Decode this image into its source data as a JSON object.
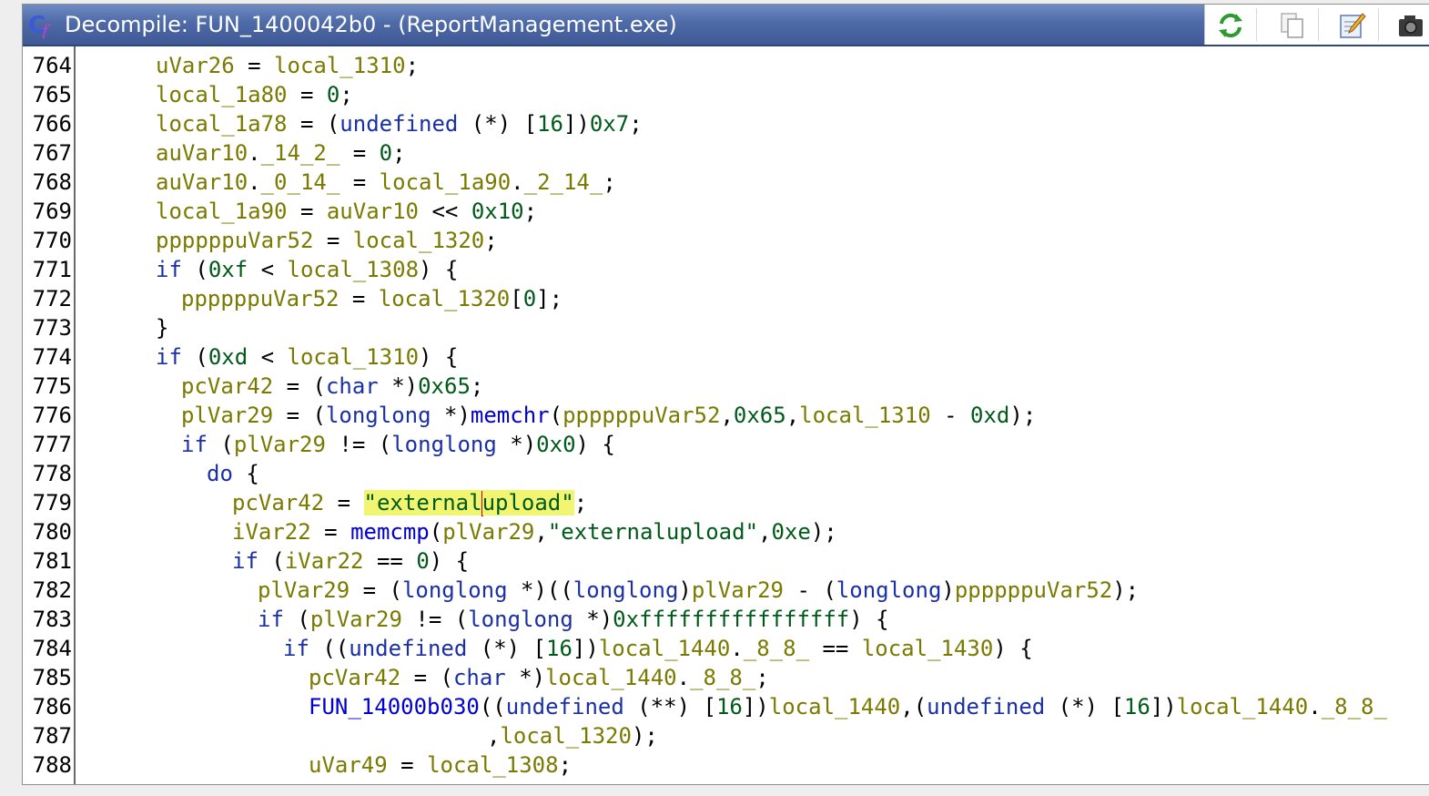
{
  "window": {
    "title": "Decompile: FUN_1400042b0 -  (ReportManagement.exe)",
    "toolbar": [
      "refresh-icon",
      "copy-icon",
      "edit-icon",
      "snapshot-icon"
    ]
  },
  "colors": {
    "titlebar": "#4e6aa7",
    "variable": "#7a7a00",
    "keyword": "#1a2fa8",
    "function": "#0000d0",
    "constant": "#005a1a",
    "highlight": "#f1f572",
    "cursor": "#d00000"
  },
  "code": {
    "line_numbers": [
      "764",
      "765",
      "766",
      "767",
      "768",
      "769",
      "770",
      "771",
      "772",
      "773",
      "774",
      "775",
      "776",
      "777",
      "778",
      "779",
      "780",
      "781",
      "782",
      "783",
      "784",
      "785",
      "786",
      "787",
      "788"
    ],
    "lines": [
      [
        [
          "v",
          "uVar26"
        ],
        [
          "p",
          " = "
        ],
        [
          "v",
          "local_1310"
        ],
        [
          "p",
          ";"
        ]
      ],
      [
        [
          "v",
          "local_1a80"
        ],
        [
          "p",
          " = "
        ],
        [
          "c",
          "0"
        ],
        [
          "p",
          ";"
        ]
      ],
      [
        [
          "v",
          "local_1a78"
        ],
        [
          "p",
          " = ("
        ],
        [
          "k",
          "undefined"
        ],
        [
          "p",
          " (*) ["
        ],
        [
          "c",
          "16"
        ],
        [
          "p",
          "])"
        ],
        [
          "c",
          "0x7"
        ],
        [
          "p",
          ";"
        ]
      ],
      [
        [
          "v",
          "auVar10"
        ],
        [
          "p",
          "."
        ],
        [
          "v",
          "_14_2_"
        ],
        [
          "p",
          " = "
        ],
        [
          "c",
          "0"
        ],
        [
          "p",
          ";"
        ]
      ],
      [
        [
          "v",
          "auVar10"
        ],
        [
          "p",
          "."
        ],
        [
          "v",
          "_0_14_"
        ],
        [
          "p",
          " = "
        ],
        [
          "v",
          "local_1a90"
        ],
        [
          "p",
          "."
        ],
        [
          "v",
          "_2_14_"
        ],
        [
          "p",
          ";"
        ]
      ],
      [
        [
          "v",
          "local_1a90"
        ],
        [
          "p",
          " = "
        ],
        [
          "v",
          "auVar10"
        ],
        [
          "p",
          " << "
        ],
        [
          "c",
          "0x10"
        ],
        [
          "p",
          ";"
        ]
      ],
      [
        [
          "v",
          "ppppppuVar52"
        ],
        [
          "p",
          " = "
        ],
        [
          "v",
          "local_1320"
        ],
        [
          "p",
          ";"
        ]
      ],
      [
        [
          "k",
          "if"
        ],
        [
          "p",
          " ("
        ],
        [
          "c",
          "0xf"
        ],
        [
          "p",
          " < "
        ],
        [
          "v",
          "local_1308"
        ],
        [
          "p",
          ") {"
        ]
      ],
      [
        [
          "v",
          "ppppppuVar52"
        ],
        [
          "p",
          " = "
        ],
        [
          "v",
          "local_1320"
        ],
        [
          "p",
          "["
        ],
        [
          "c",
          "0"
        ],
        [
          "p",
          "];"
        ]
      ],
      [
        [
          "p",
          "}"
        ]
      ],
      [
        [
          "k",
          "if"
        ],
        [
          "p",
          " ("
        ],
        [
          "c",
          "0xd"
        ],
        [
          "p",
          " < "
        ],
        [
          "v",
          "local_1310"
        ],
        [
          "p",
          ") {"
        ]
      ],
      [
        [
          "v",
          "pcVar42"
        ],
        [
          "p",
          " = ("
        ],
        [
          "k",
          "char"
        ],
        [
          "p",
          " *)"
        ],
        [
          "c",
          "0x65"
        ],
        [
          "p",
          ";"
        ]
      ],
      [
        [
          "v",
          "plVar29"
        ],
        [
          "p",
          " = ("
        ],
        [
          "k",
          "longlong"
        ],
        [
          "p",
          " *)"
        ],
        [
          "f",
          "memchr"
        ],
        [
          "p",
          "("
        ],
        [
          "v",
          "ppppppuVar52"
        ],
        [
          "p",
          ","
        ],
        [
          "c",
          "0x65"
        ],
        [
          "p",
          ","
        ],
        [
          "v",
          "local_1310"
        ],
        [
          "p",
          " - "
        ],
        [
          "c",
          "0xd"
        ],
        [
          "p",
          ");"
        ]
      ],
      [
        [
          "k",
          "if"
        ],
        [
          "p",
          " ("
        ],
        [
          "v",
          "plVar29"
        ],
        [
          "p",
          " != ("
        ],
        [
          "k",
          "longlong"
        ],
        [
          "p",
          " *)"
        ],
        [
          "c",
          "0x0"
        ],
        [
          "p",
          ") {"
        ]
      ],
      [
        [
          "k",
          "do"
        ],
        [
          "p",
          " {"
        ]
      ],
      [
        [
          "v",
          "pcVar42"
        ],
        [
          "p",
          " = "
        ],
        [
          "h",
          "\"external"
        ],
        [
          "cur",
          ""
        ],
        [
          "h",
          "upload\""
        ],
        [
          "p",
          ";"
        ]
      ],
      [
        [
          "v",
          "iVar22"
        ],
        [
          "p",
          " = "
        ],
        [
          "f",
          "memcmp"
        ],
        [
          "p",
          "("
        ],
        [
          "v",
          "plVar29"
        ],
        [
          "p",
          ","
        ],
        [
          "s",
          "\"externalupload\""
        ],
        [
          "p",
          ","
        ],
        [
          "c",
          "0xe"
        ],
        [
          "p",
          ");"
        ]
      ],
      [
        [
          "k",
          "if"
        ],
        [
          "p",
          " ("
        ],
        [
          "v",
          "iVar22"
        ],
        [
          "p",
          " == "
        ],
        [
          "c",
          "0"
        ],
        [
          "p",
          ") {"
        ]
      ],
      [
        [
          "v",
          "plVar29"
        ],
        [
          "p",
          " = ("
        ],
        [
          "k",
          "longlong"
        ],
        [
          "p",
          " *)(("
        ],
        [
          "k",
          "longlong"
        ],
        [
          "p",
          ")"
        ],
        [
          "v",
          "plVar29"
        ],
        [
          "p",
          " - ("
        ],
        [
          "k",
          "longlong"
        ],
        [
          "p",
          ")"
        ],
        [
          "v",
          "ppppppuVar52"
        ],
        [
          "p",
          ");"
        ]
      ],
      [
        [
          "k",
          "if"
        ],
        [
          "p",
          " ("
        ],
        [
          "v",
          "plVar29"
        ],
        [
          "p",
          " != ("
        ],
        [
          "k",
          "longlong"
        ],
        [
          "p",
          " *)"
        ],
        [
          "c",
          "0xffffffffffffffff"
        ],
        [
          "p",
          ") {"
        ]
      ],
      [
        [
          "k",
          "if"
        ],
        [
          "p",
          " (("
        ],
        [
          "k",
          "undefined"
        ],
        [
          "p",
          " (*) ["
        ],
        [
          "c",
          "16"
        ],
        [
          "p",
          "])"
        ],
        [
          "v",
          "local_1440"
        ],
        [
          "p",
          "."
        ],
        [
          "v",
          "_8_8_"
        ],
        [
          "p",
          " == "
        ],
        [
          "v",
          "local_1430"
        ],
        [
          "p",
          ") {"
        ]
      ],
      [
        [
          "v",
          "pcVar42"
        ],
        [
          "p",
          " = ("
        ],
        [
          "k",
          "char"
        ],
        [
          "p",
          " *)"
        ],
        [
          "v",
          "local_1440"
        ],
        [
          "p",
          "."
        ],
        [
          "v",
          "_8_8_"
        ],
        [
          "p",
          ";"
        ]
      ],
      [
        [
          "f",
          "FUN_14000b030"
        ],
        [
          "p",
          "(("
        ],
        [
          "k",
          "undefined"
        ],
        [
          "p",
          " (**) ["
        ],
        [
          "c",
          "16"
        ],
        [
          "p",
          "])"
        ],
        [
          "v",
          "local_1440"
        ],
        [
          "p",
          ",("
        ],
        [
          "k",
          "undefined"
        ],
        [
          "p",
          " (*) ["
        ],
        [
          "c",
          "16"
        ],
        [
          "p",
          "])"
        ],
        [
          "v",
          "local_1440"
        ],
        [
          "p",
          "."
        ],
        [
          "v",
          "_8_8_"
        ]
      ],
      [
        [
          "p",
          ","
        ],
        [
          "v",
          "local_1320"
        ],
        [
          "p",
          ");"
        ]
      ],
      [
        [
          "v",
          "uVar49"
        ],
        [
          "p",
          " = "
        ],
        [
          "v",
          "local_1308"
        ],
        [
          "p",
          ";"
        ]
      ]
    ]
  }
}
